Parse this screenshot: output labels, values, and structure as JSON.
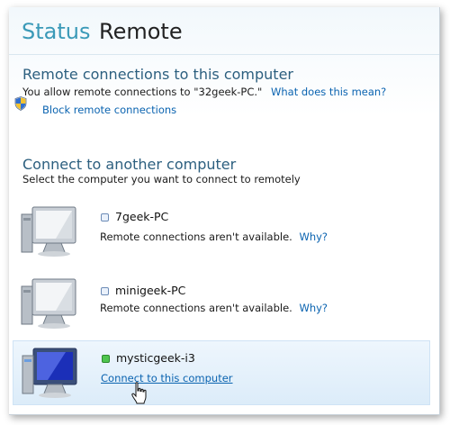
{
  "tabs": {
    "status": "Status",
    "remote": "Remote"
  },
  "remote_section": {
    "title": "Remote connections to this computer",
    "allow_text": "You allow remote connections to \"32geek-PC.\"",
    "help_link": "What does this mean?",
    "block_link": "Block remote connections"
  },
  "connect_section": {
    "title": "Connect to another computer",
    "subtitle": "Select the computer you want to connect to remotely"
  },
  "computers": [
    {
      "name": "7geek-PC",
      "status": "Remote connections aren't available.",
      "why": "Why?"
    },
    {
      "name": "minigeek-PC",
      "status": "Remote connections aren't available.",
      "why": "Why?"
    },
    {
      "name": "mysticgeek-i3",
      "action": "Connect to this computer"
    }
  ],
  "colors": {
    "accent": "#3b9ab8",
    "link": "#0a63b0",
    "heading": "#2c5f7f",
    "online": "#4fc54f"
  }
}
